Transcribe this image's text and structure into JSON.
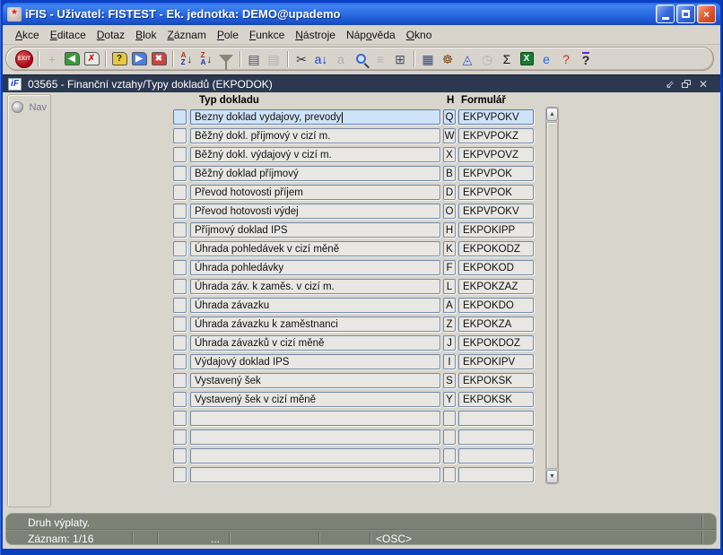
{
  "window": {
    "title": "iFIS - Uživatel: FISTEST - Ek. jednotka: DEMO@upademo"
  },
  "menubar": {
    "items": [
      {
        "label": "Akce",
        "key": 0
      },
      {
        "label": "Editace",
        "key": 0
      },
      {
        "label": "Dotaz",
        "key": 0
      },
      {
        "label": "Blok",
        "key": 0
      },
      {
        "label": "Záznam",
        "key": 0
      },
      {
        "label": "Pole",
        "key": 0
      },
      {
        "label": "Funkce",
        "key": 0
      },
      {
        "label": "Nástroje",
        "key": 0
      },
      {
        "label": "Nápověda",
        "key": 3
      },
      {
        "label": "Okno",
        "key": 0
      }
    ]
  },
  "toolbar": {
    "items": [
      {
        "name": "exit-button",
        "kind": "exit",
        "glyph": "EXIT"
      },
      {
        "kind": "sep"
      },
      {
        "name": "new-record-button",
        "kind": "glyph",
        "glyph": "+",
        "fg": "#8a8678",
        "disabled": true
      },
      {
        "name": "copy-record-button",
        "kind": "disk",
        "glyph": "◀",
        "fg": "#ffffff",
        "bg": "#3a9a3a"
      },
      {
        "name": "delete-record-button",
        "kind": "disk",
        "glyph": "✗",
        "fg": "#c22222",
        "bg": "#e8e8e4"
      },
      {
        "kind": "sep"
      },
      {
        "name": "enter-query-button",
        "kind": "disk",
        "glyph": "?",
        "fg": "#222222",
        "bg": "#e8c93a"
      },
      {
        "name": "execute-query-button",
        "kind": "disk",
        "glyph": "▶",
        "fg": "#ffffff",
        "bg": "#4a7de0"
      },
      {
        "name": "cancel-query-button",
        "kind": "disk",
        "glyph": "✖",
        "fg": "#ffffff",
        "bg": "#d04040"
      },
      {
        "kind": "sep"
      },
      {
        "name": "sort-ascending-button",
        "kind": "az"
      },
      {
        "name": "sort-descending-button",
        "kind": "za"
      },
      {
        "name": "filter-button",
        "kind": "funnel"
      },
      {
        "kind": "sep"
      },
      {
        "name": "print-button",
        "kind": "glyph",
        "glyph": "▤",
        "fg": "#4a4f66"
      },
      {
        "name": "print-setup-button",
        "kind": "glyph",
        "glyph": "▤",
        "fg": "#8a8678",
        "disabled": true
      },
      {
        "kind": "sep"
      },
      {
        "name": "cut-button",
        "kind": "glyph",
        "glyph": "✂",
        "fg": "#333333"
      },
      {
        "name": "paste-button",
        "kind": "glyph",
        "glyph": "a↓",
        "fg": "#2244cc"
      },
      {
        "name": "copy-button",
        "kind": "glyph",
        "glyph": "a",
        "fg": "#8a8678",
        "disabled": true
      },
      {
        "name": "find-button",
        "kind": "mag"
      },
      {
        "name": "list-values-button",
        "kind": "glyph",
        "glyph": "≡",
        "fg": "#8a8678",
        "disabled": true
      },
      {
        "name": "tree-view-button",
        "kind": "glyph",
        "glyph": "⊞",
        "fg": "#44506a"
      },
      {
        "kind": "sep"
      },
      {
        "name": "card-index-button",
        "kind": "glyph",
        "glyph": "▦",
        "fg": "#3a4a7a"
      },
      {
        "name": "navigator-helm-button",
        "kind": "glyph",
        "glyph": "☸",
        "fg": "#7a4a1a"
      },
      {
        "name": "pyramid-view-button",
        "kind": "glyph",
        "glyph": "◬",
        "fg": "#2a5ad0"
      },
      {
        "name": "history-clock-button",
        "kind": "glyph",
        "glyph": "◷",
        "fg": "#8a8678",
        "disabled": true
      },
      {
        "name": "sum-button",
        "kind": "glyph",
        "glyph": "Σ",
        "fg": "#111111"
      },
      {
        "name": "excel-export-button",
        "kind": "excel"
      },
      {
        "name": "browser-button",
        "kind": "glyph",
        "glyph": "e",
        "fg": "#2a6ad4"
      },
      {
        "name": "context-help-button",
        "kind": "glyph",
        "glyph": "?",
        "fg": "#cc3311"
      },
      {
        "name": "help-button",
        "kind": "help",
        "glyph": "?",
        "fg": "#222222"
      }
    ]
  },
  "inner_window": {
    "logo_text": "iF",
    "title": "03565 - Finanční vztahy/Typy dokladů (EKPODOK)"
  },
  "nav": {
    "label": "Nav"
  },
  "form": {
    "columns": {
      "typ": "Typ dokladu",
      "h": "H",
      "formular": "Formulář"
    },
    "rows": [
      {
        "typ": "Bezny doklad vydajovy, prevody",
        "h": "Q",
        "formular": "EKPVPOKV",
        "selected": true
      },
      {
        "typ": "Běžný dokl. příjmový v cizí m.",
        "h": "W",
        "formular": "EKPVPOKZ"
      },
      {
        "typ": "Běžný dokl. výdajový v cizí m.",
        "h": "X",
        "formular": "EKPVPOVZ"
      },
      {
        "typ": "Běžný doklad příjmový",
        "h": "B",
        "formular": "EKPVPOK"
      },
      {
        "typ": "Převod hotovosti příjem",
        "h": "D",
        "formular": "EKPVPOK"
      },
      {
        "typ": "Převod hotovosti výdej",
        "h": "O",
        "formular": "EKPVPOKV"
      },
      {
        "typ": "Příjmový doklad IPS",
        "h": "H",
        "formular": "EKPOKIPP"
      },
      {
        "typ": "Úhrada pohledávek v cizí měně",
        "h": "K",
        "formular": "EKPOKODZ"
      },
      {
        "typ": "Úhrada pohledávky",
        "h": "F",
        "formular": "EKPOKOD"
      },
      {
        "typ": "Úhrada záv. k zaměs. v cizí m.",
        "h": "L",
        "formular": "EKPOKZAZ"
      },
      {
        "typ": "Úhrada závazku",
        "h": "A",
        "formular": "EKPOKDO"
      },
      {
        "typ": "Úhrada závazku k zaměstnanci",
        "h": "Z",
        "formular": "EKPOKZA"
      },
      {
        "typ": "Úhrada závazků v cizí měně",
        "h": "J",
        "formular": "EKPOKDOZ"
      },
      {
        "typ": "Výdajový doklad IPS",
        "h": "I",
        "formular": "EKPOKIPV"
      },
      {
        "typ": "Vystavený šek",
        "h": "S",
        "formular": "EKPOKSK"
      },
      {
        "typ": "Vystavený šek v cizí měně",
        "h": "Y",
        "formular": "EKPOKSK"
      },
      {
        "typ": "",
        "h": "",
        "formular": ""
      },
      {
        "typ": "",
        "h": "",
        "formular": ""
      },
      {
        "typ": "",
        "h": "",
        "formular": ""
      },
      {
        "typ": "",
        "h": "",
        "formular": ""
      }
    ]
  },
  "statusbar": {
    "message": "Druh výplaty.",
    "record": "Záznam: 1/16",
    "dots": "...",
    "osc": "<OSC>"
  }
}
